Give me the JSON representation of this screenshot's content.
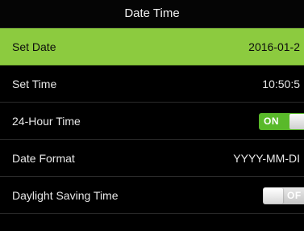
{
  "header": {
    "title": "Date Time"
  },
  "rows": [
    {
      "label": "Set Date",
      "value": "2016-01-2"
    },
    {
      "label": "Set Time",
      "value": "10:50:5"
    },
    {
      "label": "24-Hour Time",
      "toggle": "ON",
      "state": true
    },
    {
      "label": "Date Format",
      "value": "YYYY-MM-DI"
    },
    {
      "label": "Daylight Saving Time",
      "toggle": "OF",
      "state": false
    }
  ],
  "colors": {
    "selected_row": "#8ccb3f",
    "toggle_on": "#59b92a",
    "toggle_off": "#d0d0d0",
    "background": "#000000"
  }
}
